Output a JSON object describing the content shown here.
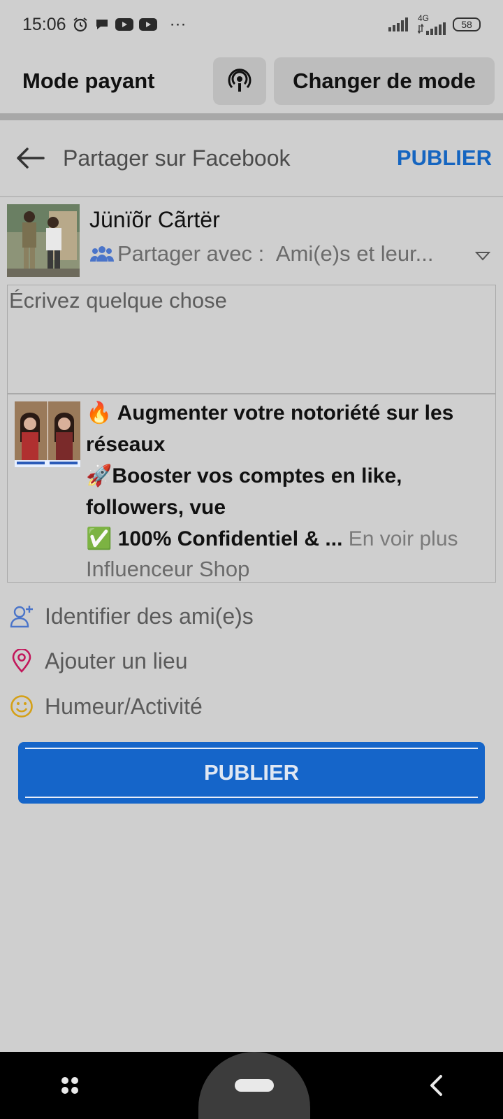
{
  "status_bar": {
    "time": "15:06",
    "network": "4G",
    "battery": "58",
    "more": "···",
    "icons": [
      "alarm-icon",
      "chat-bubble-icon",
      "youtube-icon",
      "youtube-icon",
      "signal-icon",
      "signal-4g-icon",
      "battery-icon"
    ]
  },
  "mode_bar": {
    "title": "Mode payant",
    "change_mode_label": "Changer de mode"
  },
  "share_header": {
    "title": "Partager sur Facebook",
    "publish_label": "PUBLIER"
  },
  "author": {
    "name": "Jünïõr Cãrtër",
    "audience_prefix": "Partager avec :",
    "audience_value": "Ami(e)s et leur..."
  },
  "compose": {
    "placeholder": "Écrivez quelque chose"
  },
  "ad": {
    "line1": "🔥 Augmenter votre notoriété sur les",
    "line2": "réseaux",
    "line3": "🚀Booster vos comptes en like,",
    "line4": "followers, vue",
    "line5": "✅ 100% Confidentiel & ...",
    "see_more": "En voir plus",
    "source": "Influenceur Shop"
  },
  "actions": {
    "tag_friends": "Identifier des ami(e)s",
    "add_place": "Ajouter un lieu",
    "mood": "Humeur/Activité"
  },
  "publish_button": "PUBLIER",
  "colors": {
    "accent": "#1565c0",
    "background": "#cfcfcf",
    "location": "#c2185b",
    "mood": "#d4a017"
  }
}
